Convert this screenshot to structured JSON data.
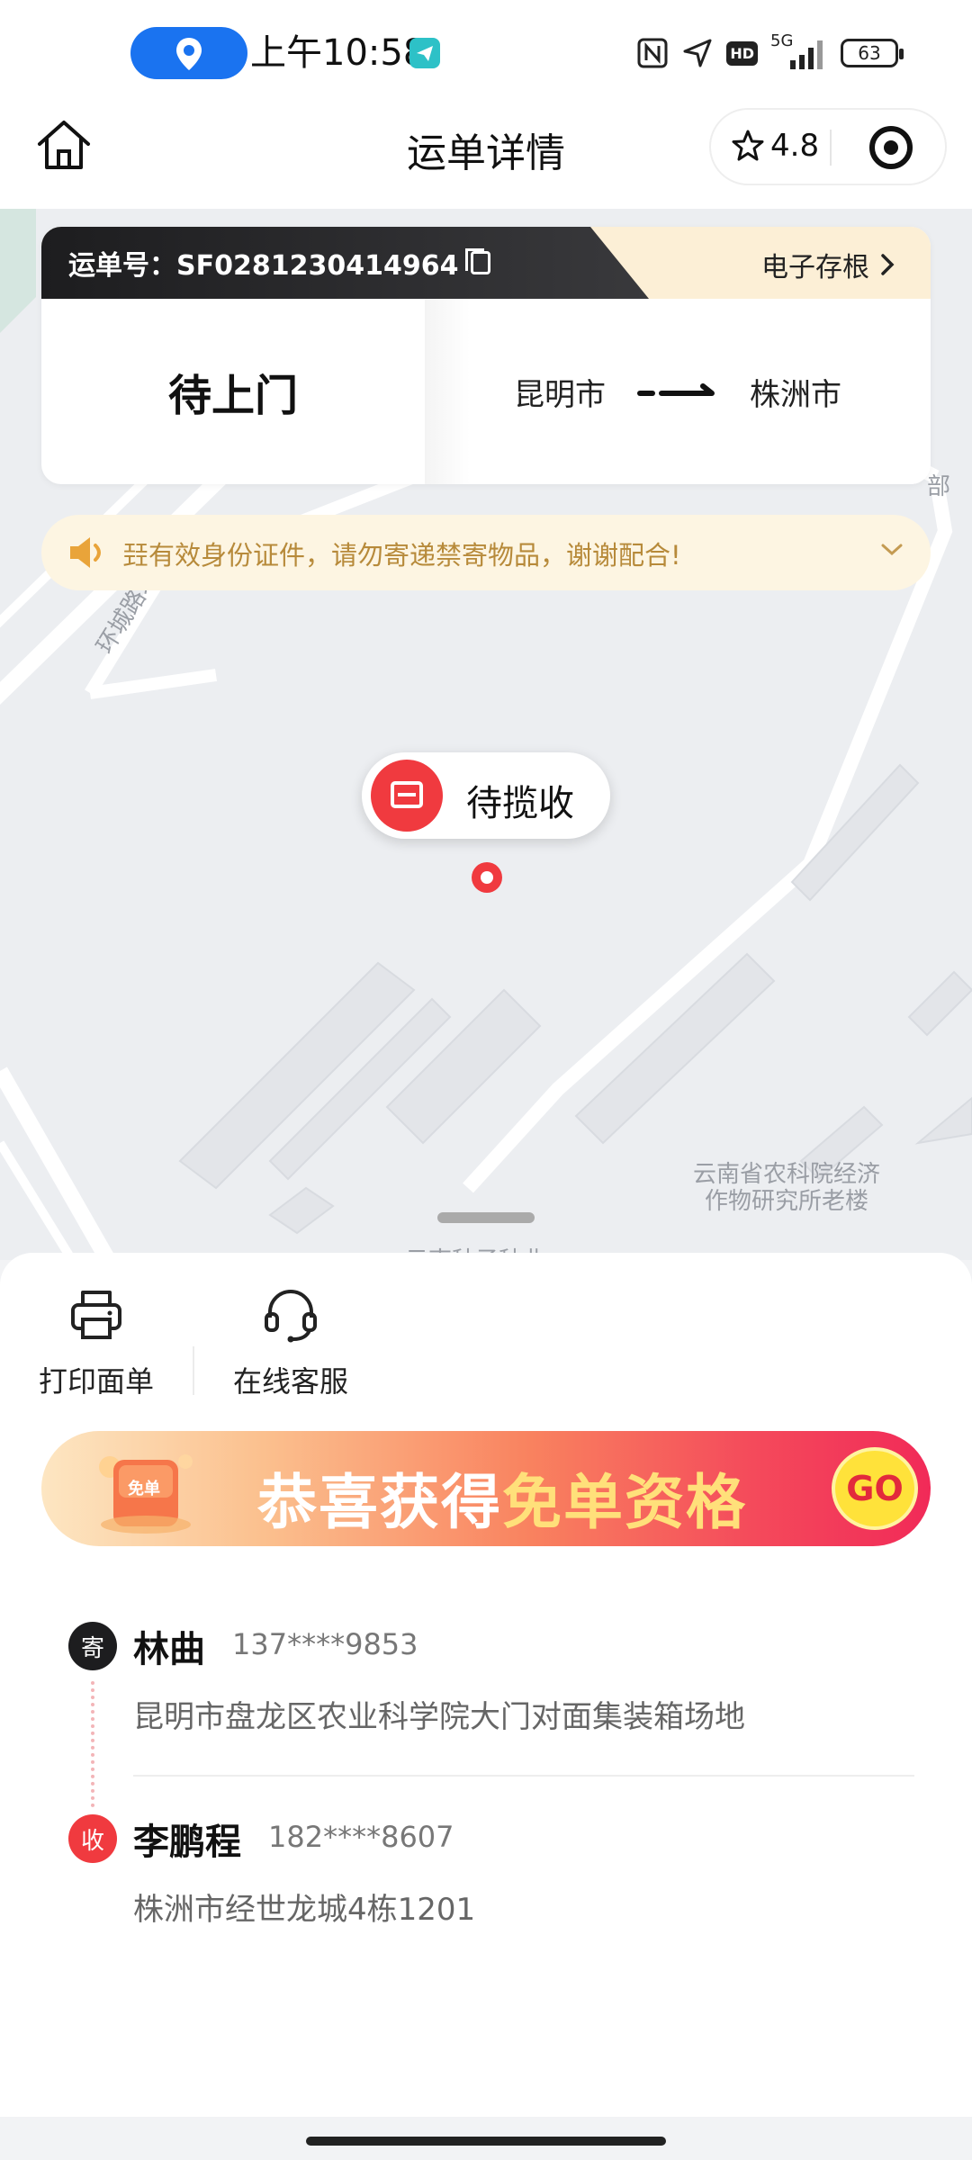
{
  "status_bar": {
    "time": "上午10:58",
    "network": "5G",
    "hd": "HD",
    "battery": "63"
  },
  "header": {
    "title": "运单详情",
    "rating": "4.8"
  },
  "waybill": {
    "label": "运单号：SF0281230414964",
    "stub": "电子存根",
    "status": "待上门",
    "origin": "昆明市",
    "destination": "株洲市"
  },
  "notice": {
    "text": "㠭有效身份证件，请勿寄递禁寄物品，谢谢配合!"
  },
  "map": {
    "marker_label": "待揽收",
    "poi_main_line1": "云南省农科院经济",
    "poi_main_line2": "作物研究所老楼",
    "poi_edge": "部",
    "poi_bottom": "云南种子种业",
    "road": "环城路北"
  },
  "actions": [
    {
      "label": "打印面单",
      "icon": "printer-icon"
    },
    {
      "label": "在线客服",
      "icon": "headset-icon"
    }
  ],
  "banner": {
    "text_main": "恭喜获得",
    "text_highlight": "免单资格",
    "gift_label": "免单",
    "go": "GO"
  },
  "sender": {
    "badge": "寄",
    "name": "林曲",
    "phone": "137****9853",
    "address": "昆明市盘龙区农业科学院大门对面集装箱场地"
  },
  "receiver": {
    "badge": "收",
    "name": "李鹏程",
    "phone": "182****8607",
    "address": "株洲市经世龙城4栋1201"
  },
  "colors": {
    "accent_red": "#f03a3f",
    "dark": "#1d1d1f",
    "notice_bg": "#fdf5e2",
    "notice_text": "#b78a3a"
  }
}
